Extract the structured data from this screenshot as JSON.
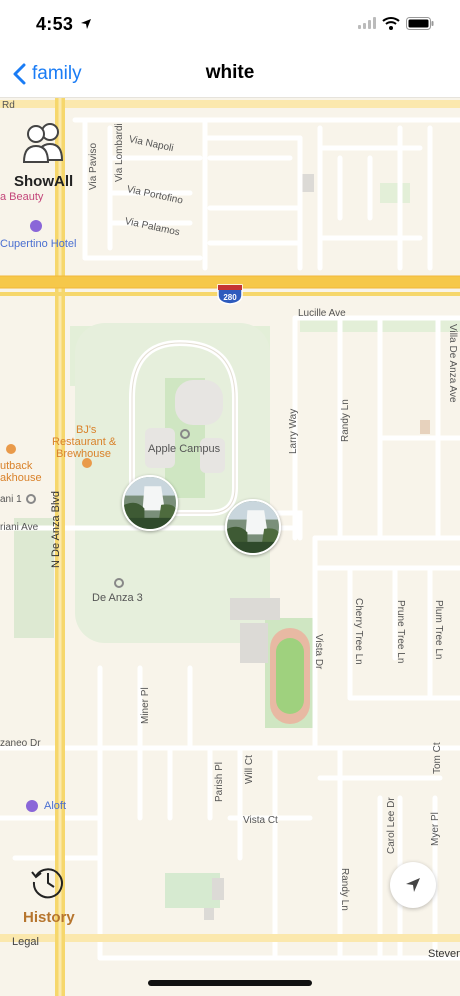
{
  "status_bar": {
    "time": "4:53"
  },
  "nav": {
    "back_label": "family",
    "title": "white"
  },
  "map": {
    "roads": {
      "rd_top": "Rd",
      "via_paviso": "Via Paviso",
      "via_lombardi": "Via Lombardi",
      "via_napoli": "Via Napoli",
      "via_portofino": "Via Portofino",
      "via_palamos": "Via Palamos",
      "interstate": "280",
      "lucille_ave": "Lucille Ave",
      "villa_de_anza_ave": "Villa De Anza Ave",
      "larry_way": "Larry Way",
      "randy_ln_top": "Randy Ln",
      "n_de_anza_blvd": "N De Anza Blvd",
      "riani_ave": "riani Ave",
      "cherry_tree_ln": "Cherry Tree Ln",
      "prune_tree_ln": "Prune Tree Ln",
      "plum_tree_ln": "Plum Tree Ln",
      "vista_dr": "Vista Dr",
      "miner_pl": "Miner Pl",
      "zaneo_dr": "zaneo Dr",
      "parish_pl": "Parish Pl",
      "will_ct": "Will Ct",
      "vista_ct": "Vista Ct",
      "tom_ct": "Tom Ct",
      "carol_lee_dr": "Carol Lee Dr",
      "myer_pl": "Myer Pl",
      "randy_ln_bottom": "Randy Ln",
      "stevens": "Steven"
    },
    "places": {
      "beauty": "a Beauty",
      "cupertino_hotel": "Cupertino Hotel",
      "bjs_line1": "BJ's",
      "bjs_line2": "Restaurant &",
      "bjs_line3": "Brewhouse",
      "outback_line1": "utback",
      "outback_line2": "akhouse",
      "apple_campus": "Apple Campus",
      "anza_1": "ani 1",
      "de_anza_3": "De Anza 3",
      "aloft": "Aloft"
    }
  },
  "controls": {
    "showall_label": "ShowAll",
    "history_label": "History",
    "legal_label": "Legal"
  },
  "colors": {
    "accent": "#1a7cf5",
    "history": "#b6752e",
    "freeway": "#f6c84a",
    "park": "#d6ead0"
  }
}
